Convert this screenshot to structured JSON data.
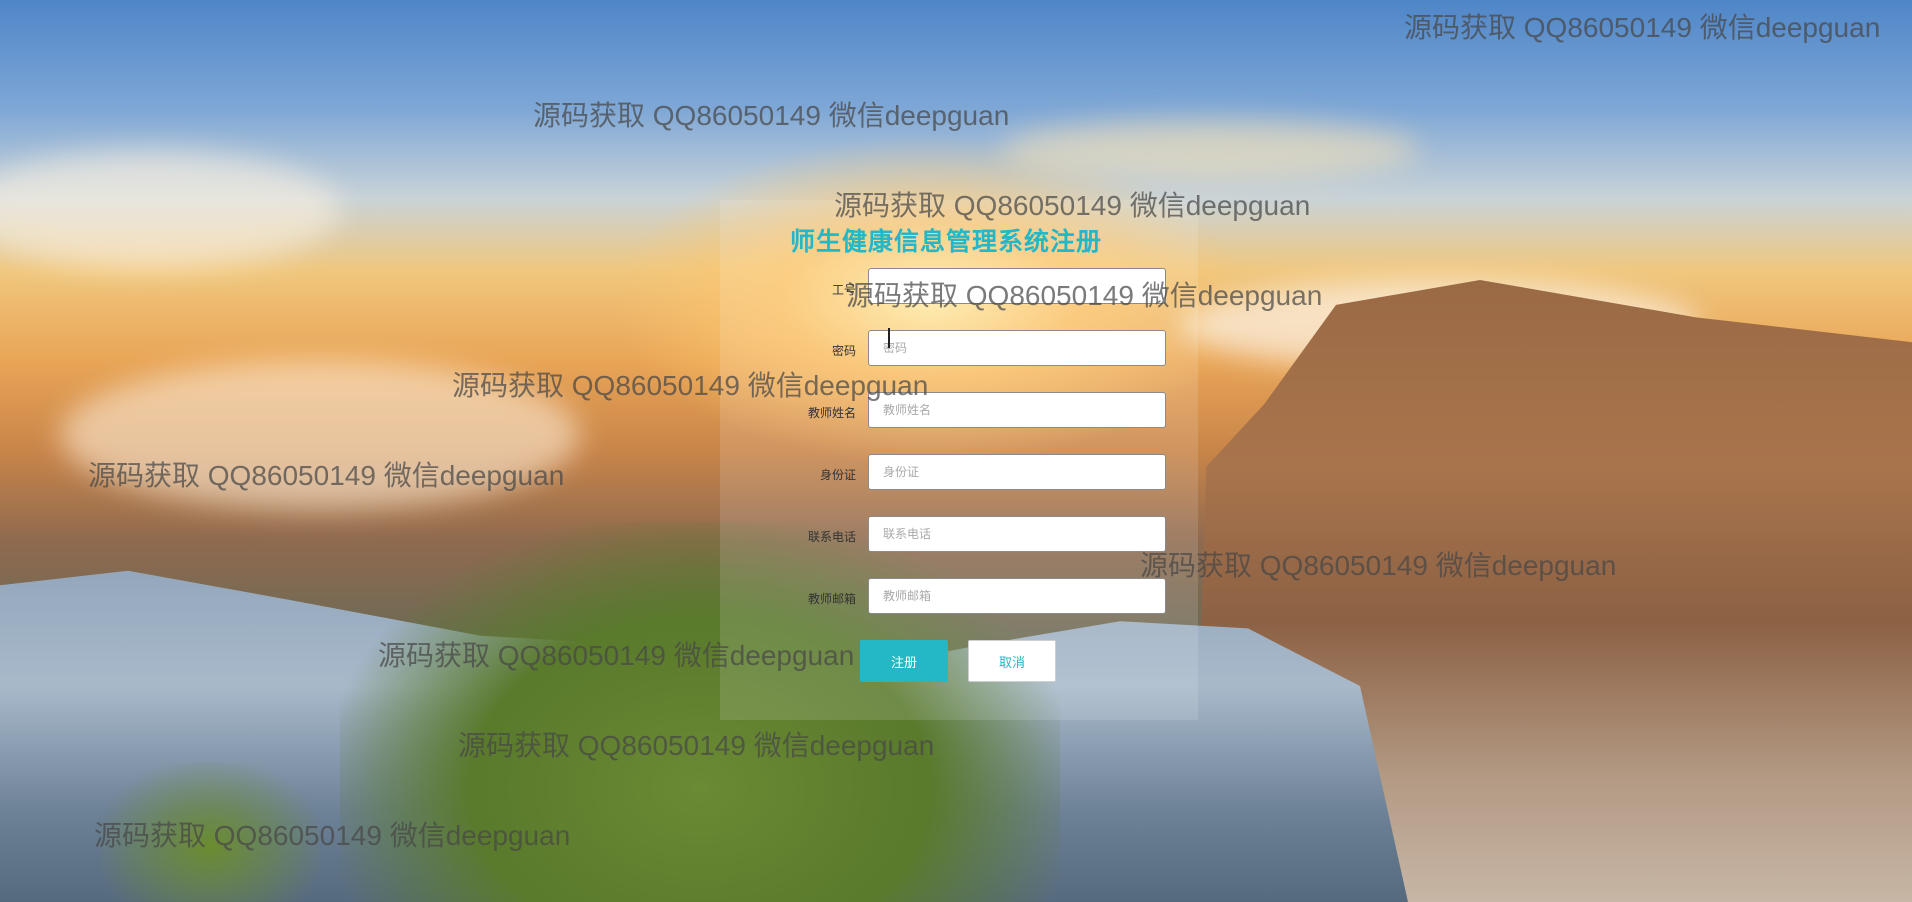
{
  "form": {
    "title": "师生健康信息管理系统注册",
    "fields": [
      {
        "label": "工号",
        "placeholder": "",
        "value": ""
      },
      {
        "label": "密码",
        "placeholder": "密码",
        "value": ""
      },
      {
        "label": "教师姓名",
        "placeholder": "教师姓名",
        "value": ""
      },
      {
        "label": "身份证",
        "placeholder": "身份证",
        "value": ""
      },
      {
        "label": "联系电话",
        "placeholder": "联系电话",
        "value": ""
      },
      {
        "label": "教师邮箱",
        "placeholder": "教师邮箱",
        "value": ""
      }
    ],
    "register_label": "注册",
    "cancel_label": "取消"
  },
  "colors": {
    "accent": "#24b7c5",
    "title": "#23b7c7"
  },
  "watermark": {
    "text": "源码获取 QQ86050149 微信deepguan"
  }
}
